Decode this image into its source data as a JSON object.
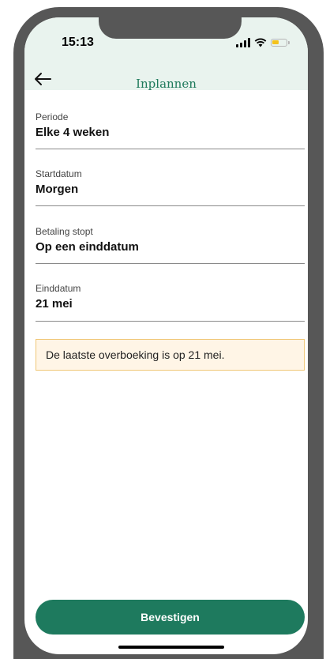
{
  "status_bar": {
    "time": "15:13",
    "icons": [
      "signal-icon",
      "wifi-icon",
      "battery-icon"
    ],
    "battery_color": "#f3c21b"
  },
  "nav": {
    "back_icon": "arrow-left-icon",
    "title": "Inplannen"
  },
  "fields": [
    {
      "label": "Periode",
      "value": "Elke 4 weken"
    },
    {
      "label": "Startdatum",
      "value": "Morgen"
    },
    {
      "label": "Betaling stopt",
      "value": "Op een einddatum"
    },
    {
      "label": "Einddatum",
      "value": "21 mei"
    }
  ],
  "notice": {
    "text": "De laatste overboeking is op 21 mei."
  },
  "confirm_button": {
    "label": "Bevestigen"
  },
  "colors": {
    "accent": "#1e7a5e",
    "header_background": "#e9f3ee",
    "notice_background": "#fff5e6",
    "notice_border": "#f0c777"
  }
}
